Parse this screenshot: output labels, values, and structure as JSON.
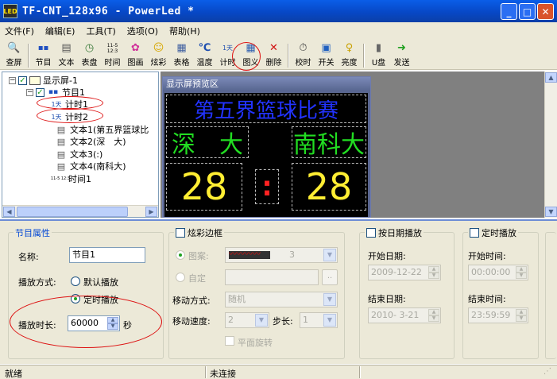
{
  "window": {
    "title": "TF-CNT_128x96 - PowerLed *",
    "minimize": "_",
    "maximize": "□",
    "close": "✕"
  },
  "menu": [
    "文件(F)",
    "编辑(E)",
    "工具(T)",
    "选项(O)",
    "帮助(H)"
  ],
  "toolbar": [
    {
      "label": "查屏",
      "icon": "magnifier-icon",
      "glyph": "🔍"
    },
    {
      "label": "节目",
      "icon": "program-icon",
      "glyph": "▪▪"
    },
    {
      "label": "文本",
      "icon": "text-doc-icon",
      "glyph": "▤"
    },
    {
      "label": "表盘",
      "icon": "clock-dial-icon",
      "glyph": "◷"
    },
    {
      "label": "时间",
      "icon": "time-icon",
      "glyph": "11-5 12:3"
    },
    {
      "label": "图画",
      "icon": "picture-icon",
      "glyph": "✿"
    },
    {
      "label": "炫彩",
      "icon": "smiley-icon",
      "glyph": "☺"
    },
    {
      "label": "表格",
      "icon": "table-icon",
      "glyph": "▦"
    },
    {
      "label": "温度",
      "icon": "thermometer-icon",
      "glyph": "℃"
    },
    {
      "label": "计时",
      "icon": "timer-icon",
      "glyph": "1天"
    },
    {
      "label": "图义",
      "icon": "grid-icon",
      "glyph": "▦"
    },
    {
      "label": "删除",
      "icon": "delete-x-icon",
      "glyph": "✕"
    },
    {
      "label": "校时",
      "icon": "calibrate-time-icon",
      "glyph": "⏱"
    },
    {
      "label": "开关",
      "icon": "power-switch-icon",
      "glyph": "▣"
    },
    {
      "label": "亮度",
      "icon": "bulb-icon",
      "glyph": "♀"
    },
    {
      "label": "U盘",
      "icon": "usb-disk-icon",
      "glyph": "▮"
    },
    {
      "label": "发送",
      "icon": "send-arrow-icon",
      "glyph": "➜"
    }
  ],
  "tree": {
    "root": "显示屏-1",
    "program": "节目1",
    "timer1_badge": "1天",
    "timer1": "计时1",
    "timer2_badge": "1天",
    "timer2": "计时2",
    "text1": "文本1(第五界篮球比",
    "text2": "文本2(深　大)",
    "text3": "文本3(:)",
    "text4": "文本4(南科大)",
    "time_badge": "11-5 12:3",
    "time1": "时间1",
    "expand_open": "−",
    "check": "✓"
  },
  "preview": {
    "title": "显示屏预览区",
    "line1": "第五界篮球比赛",
    "team_left": "深　大",
    "team_right": "南科大",
    "score_left": "28",
    "score_right": "28",
    "colon": ":",
    "colors": {
      "line1": "#2233ff",
      "teams": "#22dd22",
      "scores": "#ffee33",
      "colon": "#ff2222"
    }
  },
  "props": {
    "program_attr": {
      "legend": "节目属性",
      "name_label": "名称:",
      "name_value": "节目1",
      "play_mode_label": "播放方式:",
      "mode_default": "默认播放",
      "mode_timed": "定时播放",
      "duration_label": "播放时长:",
      "duration_value": "60000",
      "duration_unit": "秒"
    },
    "border": {
      "legend": "炫彩边框",
      "pattern_label": "图案:",
      "pattern_value": "3",
      "custom_label": "自定",
      "custom_btn": "..",
      "move_mode_label": "移动方式:",
      "move_mode_value": "随机",
      "speed_label": "移动速度:",
      "speed_value": "2",
      "step_label": "步长:",
      "step_value": "1",
      "plane_rotate": "平面旋转"
    },
    "date_play": {
      "legend": "按日期播放",
      "start_label": "开始日期:",
      "start_value": "2009-12-22",
      "end_label": "结束日期:",
      "end_value": "2010- 3-21"
    },
    "timed_play": {
      "legend": "定时播放",
      "start_label": "开始时间:",
      "start_value": "00:00:00",
      "end_label": "结束时间:",
      "end_value": "23:59:59"
    }
  },
  "status": {
    "left": "就绪",
    "middle": "未连接"
  }
}
